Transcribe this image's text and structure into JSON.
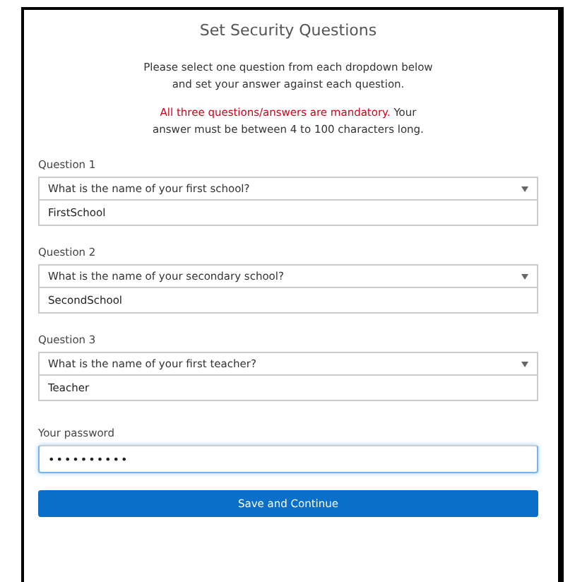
{
  "title": "Set Security Questions",
  "intro": [
    "Please select one question from each dropdown below",
    "and set your answer against each question."
  ],
  "notice": {
    "warning": "All three questions/answers are mandatory.",
    "rest": "Your",
    "line2": "answer must be between 4 to 100 characters long."
  },
  "questions": [
    {
      "label": "Question 1",
      "question": "What is the name of your first school?",
      "answer": "FirstSchool"
    },
    {
      "label": "Question 2",
      "question": "What is the name of your secondary school?",
      "answer": "SecondSchool"
    },
    {
      "label": "Question 3",
      "question": "What is the name of your first teacher?",
      "answer": "Teacher"
    }
  ],
  "password": {
    "label": "Your password",
    "value": "••••••••••",
    "focused": true
  },
  "submit": "Save and Continue"
}
